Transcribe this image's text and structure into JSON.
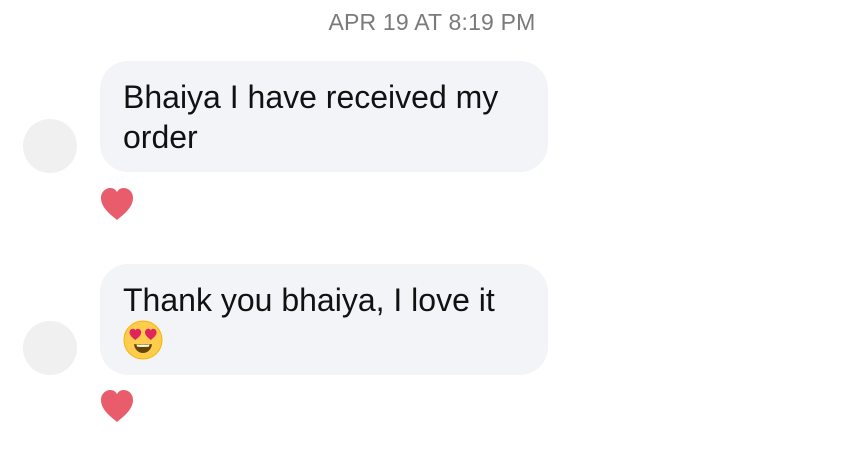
{
  "conversation": {
    "timestamp": "APR 19 AT 8:19 PM",
    "messages": [
      {
        "text": "Bhaiya I have received my order",
        "reaction": "heart-icon"
      },
      {
        "text": "Thank you bhaiya, I love it",
        "emoji": "heart-eyes-emoji",
        "reaction": "heart-icon"
      }
    ]
  },
  "colors": {
    "bubble": "#f3f4f7",
    "heart": "#e85c6b",
    "timestamp": "#7a7a7a",
    "avatar": "#f0f0f0"
  }
}
